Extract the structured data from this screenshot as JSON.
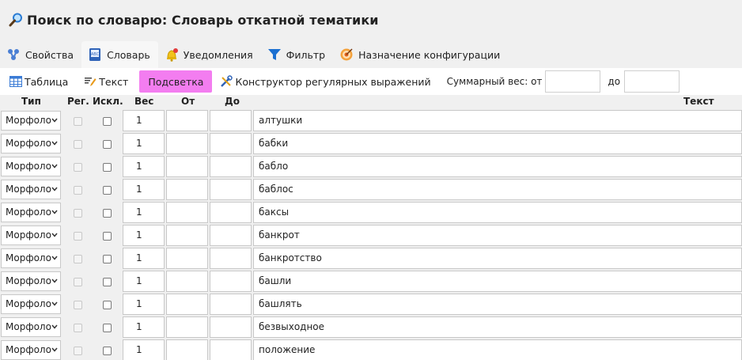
{
  "window": {
    "title": "Поиск по словарю: Словарь откатной тематики"
  },
  "tabs": [
    {
      "label": "Свойства",
      "icon": "properties-icon",
      "active": false
    },
    {
      "label": "Словарь",
      "icon": "dictionary-icon",
      "active": true
    },
    {
      "label": "Уведомления",
      "icon": "bell-icon",
      "active": false
    },
    {
      "label": "Фильтр",
      "icon": "filter-icon",
      "active": false
    },
    {
      "label": "Назначение конфигурации",
      "icon": "target-icon",
      "active": false
    }
  ],
  "toolbar": {
    "table_label": "Таблица",
    "text_label": "Текст",
    "highlight_label": "Подсветка",
    "regex_label": "Конструктор регулярных выражений",
    "weight_label": "Суммарный вес: от",
    "weight_to_label": "до",
    "weight_from_value": "",
    "weight_to_value": ""
  },
  "columns": {
    "type": "Тип",
    "reg": "Рег.",
    "excl": "Искл.",
    "weight": "Вес",
    "from": "От",
    "to": "До",
    "text": "Текст"
  },
  "rows": [
    {
      "type": "Морфоло",
      "weight": "1",
      "from": "",
      "to": "",
      "text": "алтушки"
    },
    {
      "type": "Морфоло",
      "weight": "1",
      "from": "",
      "to": "",
      "text": "бабки"
    },
    {
      "type": "Морфоло",
      "weight": "1",
      "from": "",
      "to": "",
      "text": "бабло"
    },
    {
      "type": "Морфоло",
      "weight": "1",
      "from": "",
      "to": "",
      "text": "баблос"
    },
    {
      "type": "Морфоло",
      "weight": "1",
      "from": "",
      "to": "",
      "text": "баксы"
    },
    {
      "type": "Морфоло",
      "weight": "1",
      "from": "",
      "to": "",
      "text": "банкрот"
    },
    {
      "type": "Морфоло",
      "weight": "1",
      "from": "",
      "to": "",
      "text": "банкротство"
    },
    {
      "type": "Морфоло",
      "weight": "1",
      "from": "",
      "to": "",
      "text": "башли"
    },
    {
      "type": "Морфоло",
      "weight": "1",
      "from": "",
      "to": "",
      "text": "башлять"
    },
    {
      "type": "Морфоло",
      "weight": "1",
      "from": "",
      "to": "",
      "text": "безвыходное"
    },
    {
      "type": "Морфоло",
      "weight": "1",
      "from": "",
      "to": "",
      "text": "положение"
    }
  ],
  "colors": {
    "highlight": "#f37df0",
    "accent": "#1a6fd1"
  }
}
